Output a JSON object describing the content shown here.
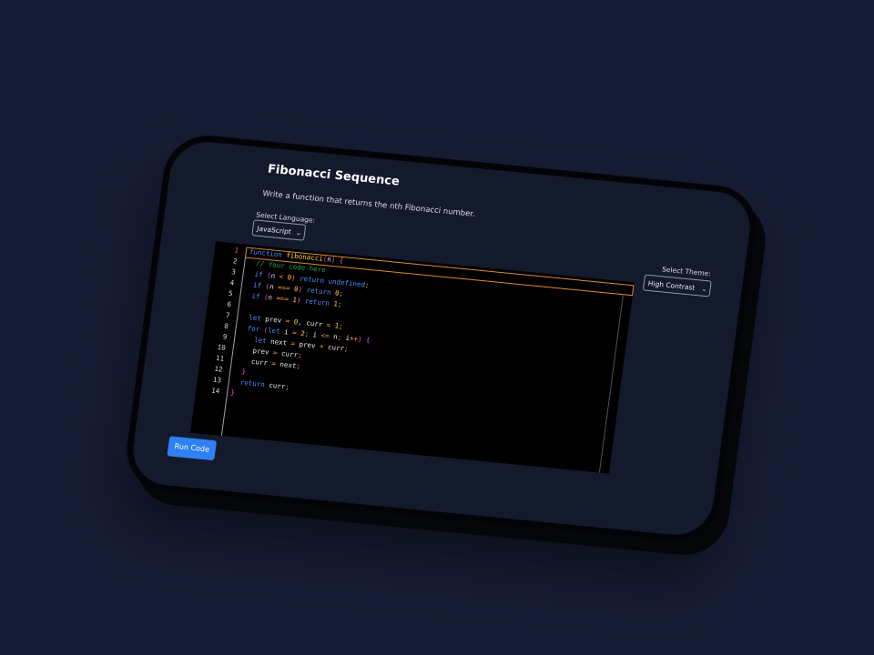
{
  "header": {
    "title": "Fibonacci Sequence",
    "description": "Write a function that returns the nth Fibonacci number."
  },
  "language": {
    "label": "Select Language:",
    "selected": "JavaScript"
  },
  "theme": {
    "label": "Select Theme:",
    "selected": "High Contrast"
  },
  "editor": {
    "active_line": 1,
    "line_numbers": [
      "1",
      "2",
      "3",
      "4",
      "5",
      "6",
      "7",
      "8",
      "9",
      "10",
      "11",
      "12",
      "13",
      "14"
    ],
    "lines": [
      "function fibonacci(n) {",
      "  // Your code here",
      "  if (n < 0) return undefined;",
      "  if (n === 0) return 0;",
      "  if (n === 1) return 1;",
      "",
      "  let prev = 0, curr = 1;",
      "  for (let i = 2; i <= n; i++) {",
      "    let next = prev + curr;",
      "    prev = curr;",
      "    curr = next;",
      "  }",
      "  return curr;",
      "}"
    ]
  },
  "actions": {
    "run_label": "Run Code"
  },
  "colors": {
    "background": "#161c33",
    "panel": "#131a2c",
    "editor_bg": "#000000",
    "keyword": "#4e8cff",
    "function_name": "#ffcf3a",
    "comment": "#29a14a",
    "active_line_border": "#e08a2c",
    "active_line_number": "#ff5a4d",
    "button": "#2f80f0"
  }
}
